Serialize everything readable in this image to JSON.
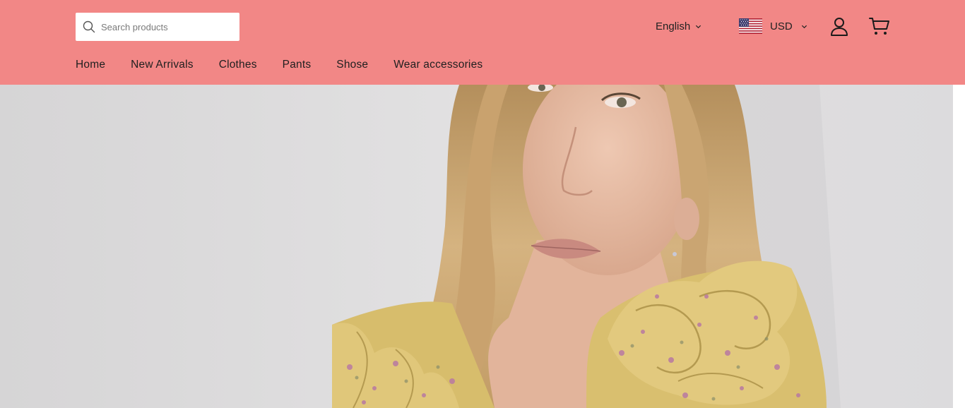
{
  "header": {
    "background_color": "#f28786",
    "search": {
      "placeholder": "Search products",
      "value": "",
      "icon": "search-icon"
    },
    "language": {
      "selected": "English",
      "icon": "chevron-down-icon"
    },
    "currency": {
      "selected": "USD",
      "flag": "us-flag-icon",
      "icon": "chevron-down-icon"
    },
    "account_icon": "user-icon",
    "cart_icon": "cart-icon"
  },
  "nav": {
    "items": [
      {
        "label": "Home"
      },
      {
        "label": "New Arrivals"
      },
      {
        "label": "Clothes"
      },
      {
        "label": "Pants"
      },
      {
        "label": "Shose"
      },
      {
        "label": "Wear accessories"
      }
    ]
  },
  "hero": {
    "image": "hero-banner-image",
    "colors": {
      "wall": "#dddcdd",
      "hair": "#c8a473",
      "skin": "#e7bfa8",
      "dress": "#d9bf6f",
      "floral": "#b879a2"
    }
  }
}
